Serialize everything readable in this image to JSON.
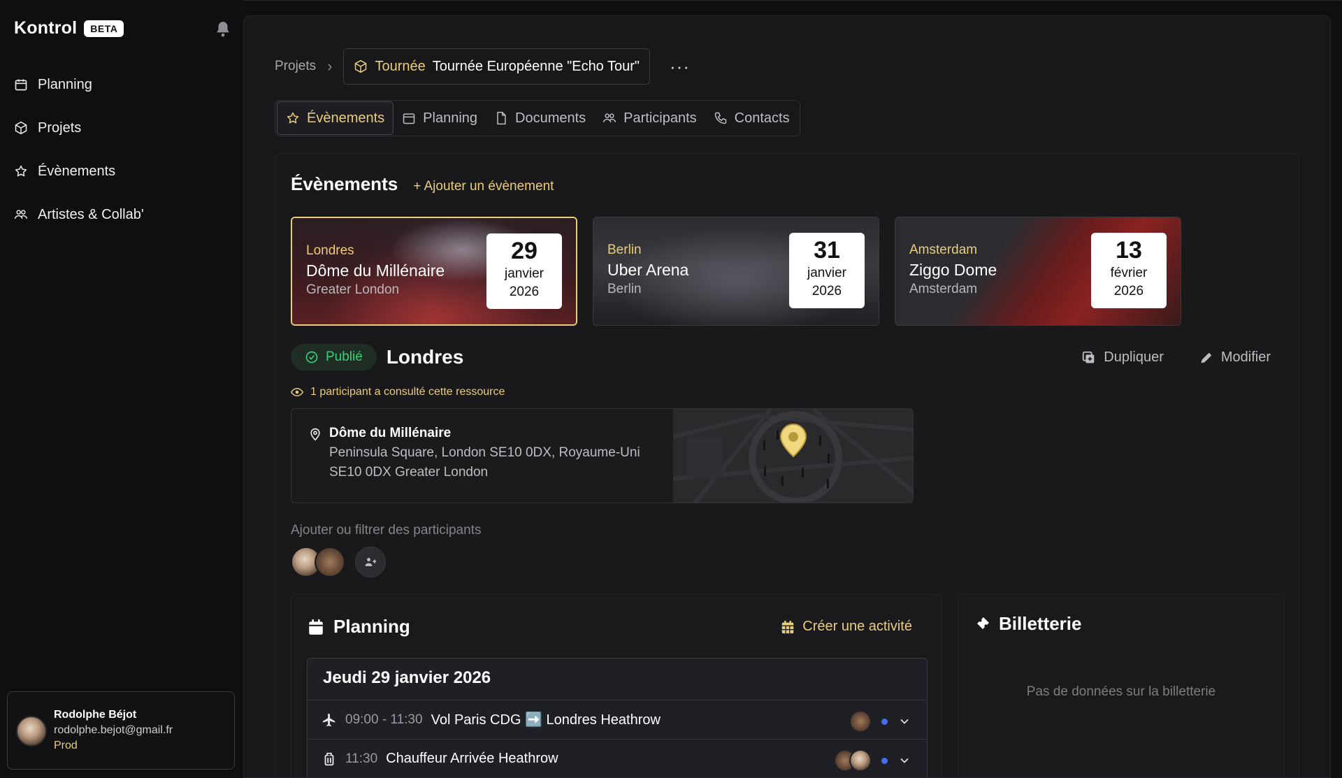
{
  "colors": {
    "accent": "#e9cd7c",
    "success": "#35d07a",
    "bg": "#0f0f11",
    "panel": "#18181b"
  },
  "sidebar": {
    "brand": "Kontrol",
    "badge": "BETA",
    "items": [
      {
        "label": "Planning",
        "icon": "calendar-icon"
      },
      {
        "label": "Projets",
        "icon": "cube-icon"
      },
      {
        "label": "Évènements",
        "icon": "star-icon"
      },
      {
        "label": "Artistes & Collab'",
        "icon": "people-icon"
      }
    ],
    "user": {
      "name": "Rodolphe Béjot",
      "email": "rodolphe.bejot@gmail.fr",
      "role": "Prod"
    }
  },
  "breadcrumb": {
    "root": "Projets",
    "type": "Tournée",
    "title": "Tournée Européenne \"Echo Tour\"",
    "more": "···"
  },
  "tabs": [
    {
      "label": "Évènements",
      "active": true
    },
    {
      "label": "Planning"
    },
    {
      "label": "Documents"
    },
    {
      "label": "Participants"
    },
    {
      "label": "Contacts"
    }
  ],
  "events_section": {
    "title": "Évènements",
    "add_label": "+ Ajouter un évènement",
    "cards": [
      {
        "city": "Londres",
        "venue": "Dôme du Millénaire",
        "region": "Greater London",
        "day": "29",
        "month": "janvier",
        "year": "2026"
      },
      {
        "city": "Berlin",
        "venue": "Uber Arena",
        "region": "Berlin",
        "day": "31",
        "month": "janvier",
        "year": "2026"
      },
      {
        "city": "Amsterdam",
        "venue": "Ziggo Dome",
        "region": "Amsterdam",
        "day": "13",
        "month": "février",
        "year": "2026"
      }
    ]
  },
  "selected_event": {
    "status": "Publié",
    "name": "Londres",
    "duplicate_label": "Dupliquer",
    "edit_label": "Modifier",
    "viewed_text": "1 participant a consulté cette ressource",
    "location": {
      "name": "Dôme du Millénaire",
      "address": "Peninsula Square, London SE10 0DX, Royaume-Uni",
      "address2": "SE10 0DX  Greater London"
    },
    "filter_placeholder": "Ajouter ou filtrer des participants"
  },
  "planning": {
    "title": "Planning",
    "create_label": "Créer une activité",
    "day_title": "Jeudi 29 janvier 2026",
    "activities": [
      {
        "time": "09:00 - 11:30",
        "label": "Vol Paris CDG ➡️ Londres Heathrow",
        "icon": "plane-icon"
      },
      {
        "time": "11:30",
        "label": "Chauffeur Arrivée Heathrow",
        "icon": "luggage-icon"
      }
    ]
  },
  "billetterie": {
    "title": "Billetterie",
    "empty": "Pas de données sur la billetterie"
  }
}
